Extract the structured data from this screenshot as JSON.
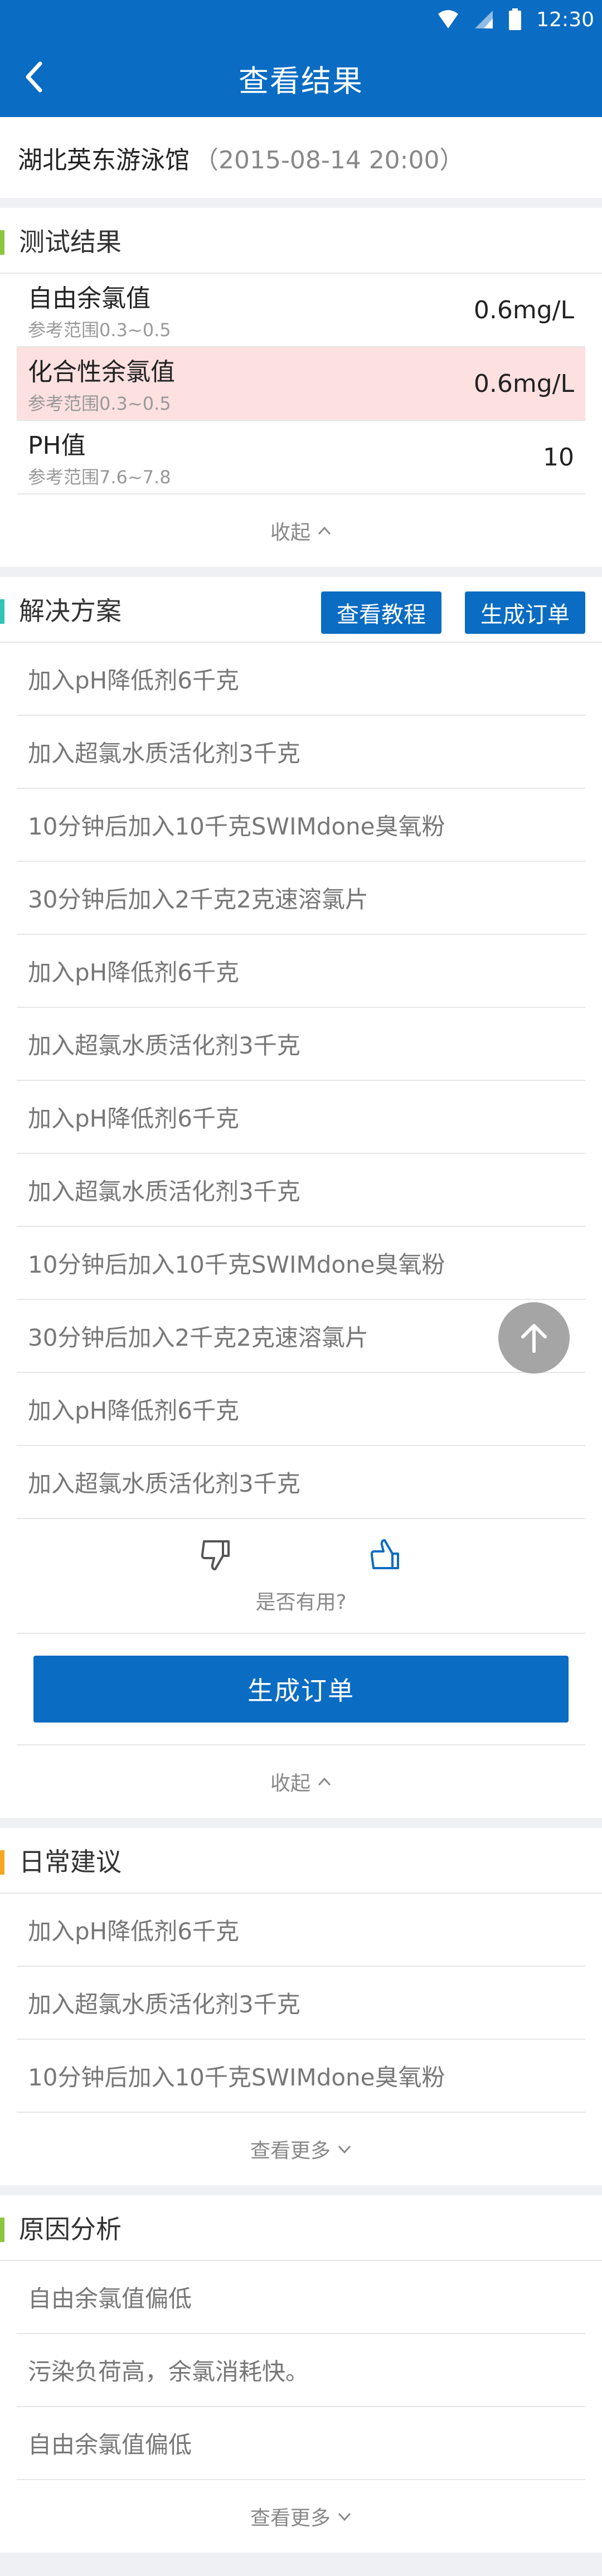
{
  "status_bar": {
    "time": "12:30",
    "wifi_icon": "wifi-icon",
    "signal_icon": "signal-icon",
    "battery_icon": "battery-icon"
  },
  "nav": {
    "title": "查看结果",
    "back_icon": "back-arrow-icon"
  },
  "venue": {
    "name": "湖北英东游泳馆",
    "time": "（2015-08-14  20:00）"
  },
  "test_results": {
    "title": "测试结果",
    "accent_color": "#8cc63f",
    "rows": [
      {
        "name": "自由余氯值",
        "range": "参考范围0.3~0.5",
        "value": "0.6mg/L",
        "alert": false
      },
      {
        "name": "化合性余氯值",
        "range": "参考范围0.3~0.5",
        "value": "0.6mg/L",
        "alert": true
      },
      {
        "name": "PH值",
        "range": "参考范围7.6~7.8",
        "value": "10",
        "alert": false
      }
    ],
    "collapse_label": "收起"
  },
  "solution": {
    "title": "解决方案",
    "accent_color": "#2ec4b6",
    "tutorial_btn": "查看教程",
    "order_btn": "生成订单",
    "items": [
      "加入pH降低剂6千克",
      "加入超氯水质活化剂3千克",
      "10分钟后加入10千克SWIMdone臭氧粉",
      "30分钟后加入2千克2克速溶氯片",
      "加入pH降低剂6千克",
      "加入超氯水质活化剂3千克",
      "加入pH降低剂6千克",
      "加入超氯水质活化剂3千克",
      "10分钟后加入10千克SWIMdone臭氧粉",
      "30分钟后加入2千克2克速溶氯片",
      "加入pH降低剂6千克",
      "加入超氯水质活化剂3千克"
    ],
    "feedback_question": "是否有用?",
    "generate_order": "生成订单",
    "collapse_label": "收起"
  },
  "daily_advice": {
    "title": "日常建议",
    "accent_color": "#f5a623",
    "items": [
      "加入pH降低剂6千克",
      "加入超氯水质活化剂3千克",
      "10分钟后加入10千克SWIMdone臭氧粉"
    ],
    "more_label": "查看更多"
  },
  "cause_analysis": {
    "title": "原因分析",
    "accent_color": "#8cc63f",
    "items": [
      "自由余氯值偏低",
      "污染负荷高，余氯消耗快。",
      "自由余氯值偏低"
    ],
    "more_label": "查看更多"
  },
  "colors": {
    "primary": "#0a6cc2",
    "alert_bg": "#fde0e0"
  }
}
